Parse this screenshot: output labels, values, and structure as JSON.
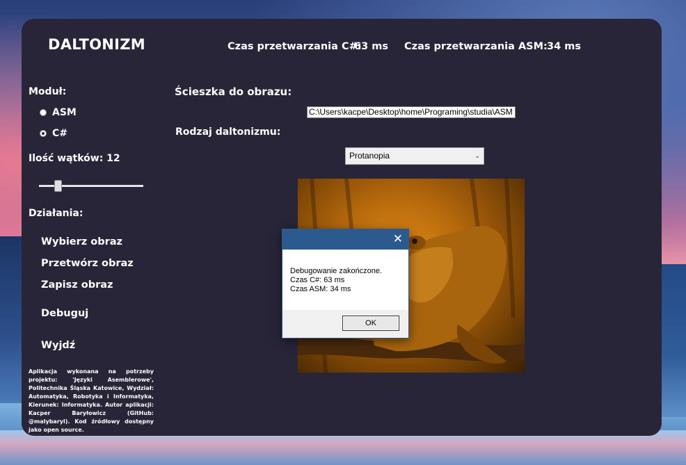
{
  "app": {
    "title": "DALTONIZM",
    "csharp_time_label": "Czas przetwarzania C#:",
    "csharp_time_value": "63 ms",
    "asm_time_label": "Czas przetwarzania ASM:",
    "asm_time_value": "34 ms"
  },
  "module": {
    "label": "Moduł:",
    "options": [
      {
        "label": "ASM",
        "selected": false
      },
      {
        "label": "C#",
        "selected": true
      }
    ]
  },
  "threads": {
    "label": "Ilość wątków: 12",
    "value": 12
  },
  "actions": {
    "label": "Działania:",
    "choose_image": "Wybierz obraz",
    "process_image": "Przetwórz obraz",
    "save_image": "Zapisz obraz",
    "debug": "Debuguj",
    "exit": "Wyjdź"
  },
  "footer": {
    "text": "Aplikacja wykonana na potrzeby projektu: 'Języki Asemblerowe', Politechnika Śląska Katowice, Wydział: Automatyka, Robotyka i Informatyka, Kierunek: Informatyka. Autor aplikacji: Kacper Baryłowicz (GitHub: @malybaryl). Kod źródłowy dostępny jako open source."
  },
  "image_path": {
    "label": "Ścieszka do obrazu:",
    "value": "C:\\Users\\kacpe\\Desktop\\home\\Programing\\studia\\ASM"
  },
  "colorblind_type": {
    "label": "Rodzaj daltonizmu:",
    "selected": "Protanopia"
  },
  "dialog": {
    "line1": "Debugowanie zakończone.",
    "line2": "Czas C#: 63 ms",
    "line3": "Czas ASM: 34 ms",
    "ok_label": "OK",
    "close_glyph": "✕"
  },
  "colors": {
    "panel_bg": "#282539",
    "dialog_titlebar": "#2c5a8e",
    "text": "#ffffff"
  }
}
